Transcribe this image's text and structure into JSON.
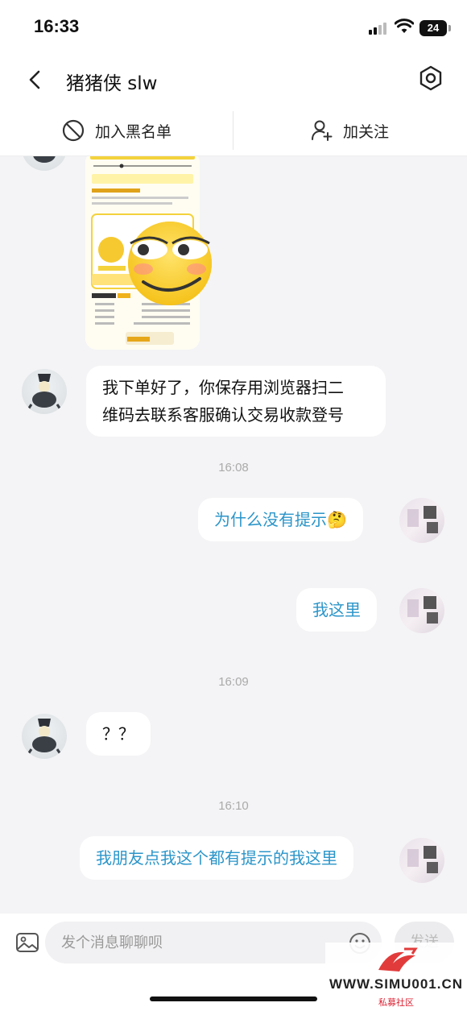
{
  "status_bar": {
    "time": "16:33",
    "battery": "24"
  },
  "nav": {
    "title": "猪猪侠 slw"
  },
  "actions": {
    "blacklist_label": "加入黑名单",
    "follow_label": "加关注"
  },
  "messages": [
    {
      "side": "left",
      "type": "image"
    },
    {
      "side": "left",
      "type": "text",
      "lines": [
        "我下单好了，你保存用浏览器扫二",
        "维码去联系客服确认交易收款登号"
      ]
    },
    {
      "side": "right",
      "type": "text",
      "text": "为什么没有提示🤔"
    },
    {
      "side": "right",
      "type": "text",
      "text": "我这里"
    },
    {
      "side": "left",
      "type": "text",
      "text": "？？"
    },
    {
      "side": "right",
      "type": "text",
      "text": "我朋友点我这个都有提示的我这里"
    }
  ],
  "timestamps": [
    "16:08",
    "16:09",
    "16:10"
  ],
  "input": {
    "placeholder": "发个消息聊聊呗",
    "send_label": "发送"
  },
  "watermark": {
    "text": "WWW.SIMU001.CN",
    "subtext": "私募社区"
  },
  "colors": {
    "background": "#f4f4f6",
    "bubble": "#ffffff",
    "right_text": "#2b95c9"
  },
  "icons": [
    "back-icon",
    "settings-icon",
    "block-icon",
    "add-user-icon",
    "image-icon",
    "emoji-icon"
  ]
}
